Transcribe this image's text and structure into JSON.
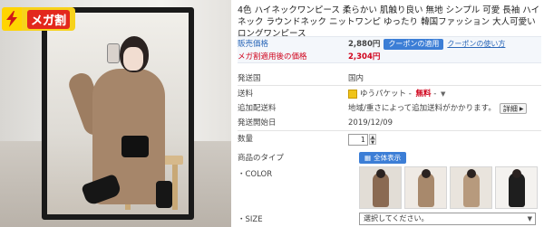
{
  "badge": {
    "label": "メガ割"
  },
  "product": {
    "title": "4色 ハイネックワンピース 柔らかい 肌触り良い 無地 シンプル 可愛 長袖 ハイネック ラウンドネック ニットワンピ ゆったり 韓国ファッション 大人可愛い ロングワンピース"
  },
  "pricing": {
    "sale_label": "販売価格",
    "sale_price": "2,880円",
    "coupon_button": "クーポンの適用",
    "coupon_link": "クーポンの使い方",
    "mega_label": "メガ割適用後の価格",
    "mega_price": "2,304円"
  },
  "shipping": {
    "origin_label": "発送国",
    "origin_value": "国内",
    "fee_label": "送料",
    "fee_method": "ゆうパケット",
    "fee_sep": "-",
    "fee_value": "無料",
    "fee_dash": "-",
    "add_label": "追加配送料",
    "add_value": "地域/重さによって追加送料がかかります。",
    "detail_button": "詳細",
    "start_label": "発送開始日",
    "start_value": "2019/12/09"
  },
  "quantity": {
    "label": "数量",
    "value": "1"
  },
  "options": {
    "type_label": "商品のタイプ",
    "view_all_button": "全体表示",
    "color_label": "・COLOR",
    "size_label": "・SIZE",
    "size_placeholder": "選択してください。"
  },
  "colors": {
    "accent_blue": "#3c7ed6",
    "sale_red": "#d0021b",
    "badge_yellow": "#f7d21b"
  },
  "thumbnails": [
    {
      "name": "color-option-1",
      "dress": "#8a6a52"
    },
    {
      "name": "color-option-2",
      "dress": "#a8896c"
    },
    {
      "name": "color-option-3",
      "dress": "#b79a7d"
    },
    {
      "name": "color-option-4",
      "dress": "#1e1e1e"
    },
    {
      "name": "color-option-5",
      "dress": "#2a2a2a"
    }
  ]
}
